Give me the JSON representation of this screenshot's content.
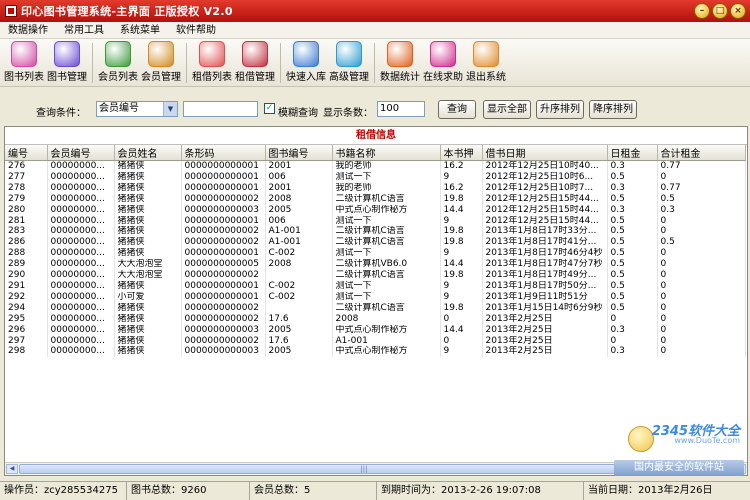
{
  "window": {
    "title": "印心图书管理系统-主界面  正版授权  V2.0"
  },
  "menu": [
    "数据操作",
    "常用工具",
    "系统菜单",
    "软件帮助"
  ],
  "toolbar": [
    {
      "label": "图书列表",
      "icon": "book-list-icon",
      "color": "#d04aa0"
    },
    {
      "label": "图书管理",
      "icon": "book-manage-icon",
      "color": "#6a4ad0"
    },
    {
      "label": "会员列表",
      "icon": "member-list-icon",
      "color": "#3a9a3a"
    },
    {
      "label": "会员管理",
      "icon": "member-manage-icon",
      "color": "#d08a20"
    },
    {
      "label": "租借列表",
      "icon": "rent-list-icon",
      "color": "#e05050"
    },
    {
      "label": "租借管理",
      "icon": "rent-manage-icon",
      "color": "#c03040"
    },
    {
      "label": "快速入库",
      "icon": "quick-stock-icon",
      "color": "#3a7ad0"
    },
    {
      "label": "高级管理",
      "icon": "gear-icon",
      "color": "#2a9ad0"
    },
    {
      "label": "数据统计",
      "icon": "pie-chart-icon",
      "color": "#e06020"
    },
    {
      "label": "在线求助",
      "icon": "at-help-icon",
      "color": "#d02a8a"
    },
    {
      "label": "退出系统",
      "icon": "exit-icon",
      "color": "#e08a2a"
    }
  ],
  "query": {
    "condition_label": "查询条件：",
    "field_value": "会员编号",
    "search_text": "",
    "fuzzy_label": "模糊查询",
    "count_label": "显示条数：",
    "count_value": "100",
    "btn_query": "查询",
    "btn_show_all": "显示全部",
    "btn_asc": "升序排列",
    "btn_desc": "降序排列"
  },
  "grid": {
    "title": "租借信息",
    "columns": [
      "编号",
      "会员编号",
      "会员姓名",
      "条形码",
      "图书编号",
      "书籍名称",
      "本书押",
      "借书日期",
      "日租金",
      "合计租金"
    ],
    "rows": [
      [
        "276",
        "00000000...",
        "猪猪侠",
        "0000000000001",
        "2001",
        "我的老师",
        "16.2",
        "2012年12月25日10时40...",
        "0.3",
        "0.77"
      ],
      [
        "277",
        "00000000...",
        "猪猪侠",
        "0000000000001",
        "006",
        "测试一下",
        "9",
        "2012年12月25日10时6...",
        "0.5",
        "0"
      ],
      [
        "278",
        "00000000...",
        "猪猪侠",
        "0000000000001",
        "2001",
        "我的老师",
        "16.2",
        "2012年12月25日10时7...",
        "0.3",
        "0.77"
      ],
      [
        "279",
        "00000000...",
        "猪猪侠",
        "0000000000002",
        "2008",
        "二级计算机C语言",
        "19.8",
        "2012年12月25日15时44...",
        "0.5",
        "0.5"
      ],
      [
        "280",
        "00000000...",
        "猪猪侠",
        "0000000000003",
        "2005",
        "中式点心制作秘方",
        "14.4",
        "2012年12月25日15时44...",
        "0.3",
        "0.3"
      ],
      [
        "281",
        "00000000...",
        "猪猪侠",
        "0000000000001",
        "006",
        "测试一下",
        "9",
        "2012年12月25日15时44...",
        "0.5",
        "0"
      ],
      [
        "283",
        "00000000...",
        "猪猪侠",
        "0000000000002",
        "A1-001",
        "二级计算机C语言",
        "19.8",
        "2013年1月8日17时33分...",
        "0.5",
        "0"
      ],
      [
        "286",
        "00000000...",
        "猪猪侠",
        "0000000000002",
        "A1-001",
        "二级计算机C语言",
        "19.8",
        "2013年1月8日17时41分...",
        "0.5",
        "0.5"
      ],
      [
        "288",
        "00000000...",
        "猪猪侠",
        "0000000000001",
        "C-002",
        "测试一下",
        "9",
        "2013年1月8日17时46分4秒",
        "0.5",
        "0"
      ],
      [
        "289",
        "00000000...",
        "大大泡泡堂",
        "0000000000005",
        "2008",
        "二级计算机VB6.0",
        "14.4",
        "2013年1月8日17时47分7秒",
        "0.5",
        "0"
      ],
      [
        "290",
        "00000000...",
        "大大泡泡堂",
        "0000000000002",
        "",
        "二级计算机C语言",
        "19.8",
        "2013年1月8日17时49分...",
        "0.5",
        "0"
      ],
      [
        "291",
        "00000000...",
        "猪猪侠",
        "0000000000001",
        "C-002",
        "测试一下",
        "9",
        "2013年1月8日17时50分...",
        "0.5",
        "0"
      ],
      [
        "292",
        "00000000...",
        "小可爱",
        "0000000000001",
        "C-002",
        "测试一下",
        "9",
        "2013年1月9日11时51分",
        "0.5",
        "0"
      ],
      [
        "294",
        "00000000...",
        "猪猪侠",
        "0000000000002",
        "",
        "二级计算机C语言",
        "19.8",
        "2013年1月15日14时6分9秒",
        "0.5",
        "0"
      ],
      [
        "295",
        "00000000...",
        "猪猪侠",
        "0000000000002",
        "17.6",
        "2008",
        "0",
        "2013年2月25日",
        "0",
        "0"
      ],
      [
        "296",
        "00000000...",
        "猪猪侠",
        "0000000000003",
        "2005",
        "中式点心制作秘方",
        "14.4",
        "2013年2月25日",
        "0.3",
        "0"
      ],
      [
        "297",
        "00000000...",
        "猪猪侠",
        "0000000000002",
        "17.6",
        "A1-001",
        "0",
        "2013年2月25日",
        "0",
        "0"
      ],
      [
        "298",
        "00000000...",
        "猪猪侠",
        "0000000000003",
        "2005",
        "中式点心制作秘方",
        "9",
        "2013年2月25日",
        "0.3",
        "0"
      ]
    ]
  },
  "watermark": {
    "logo": "2345软件大全",
    "site": "www.DuoTe.com",
    "bar": "国内最安全的软件站"
  },
  "status": {
    "operator": "操作员：zcy285534275",
    "book_total": "图书总数：9260",
    "member_total": "会员总数：5",
    "expire": "到期时间为：2013-2-26  19:07:08",
    "current_date": "当前日期：2013年2月26日"
  },
  "colors": {
    "title_bar": "#c81e14",
    "grid_title": "#c00000"
  }
}
